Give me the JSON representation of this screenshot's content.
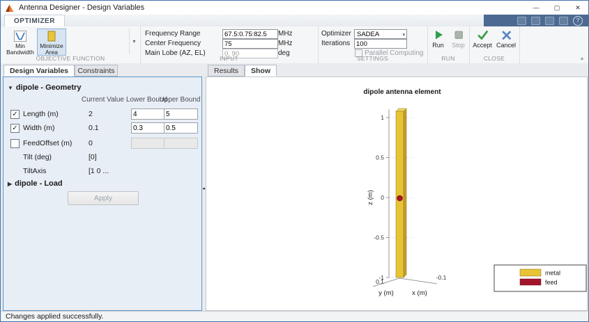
{
  "window": {
    "title": "Antenna Designer - Design Variables",
    "minimize_glyph": "—",
    "maximize_glyph": "▢",
    "close_glyph": "✕"
  },
  "ribbon": {
    "tab_label": "OPTIMIZER",
    "help_glyph": "?",
    "collapse_glyph": "▴",
    "gallery_arrow": "▾",
    "dropdown_arrow": "▾",
    "objective": {
      "section_label": "OBJECTIVE FUNCTION",
      "min_bandwidth_label": "Min Bandwidth",
      "minimize_area_label": "Minimize Area"
    },
    "input": {
      "section_label": "INPUT",
      "rows": [
        {
          "label": "Frequency Range",
          "value": "67.5:0.75:82.5",
          "unit": "MHz"
        },
        {
          "label": "Center Frequency",
          "value": "75",
          "unit": "MHz"
        },
        {
          "label": "Main Lobe (AZ, EL)",
          "value": "0, 90",
          "unit": "deg"
        }
      ]
    },
    "settings": {
      "section_label": "SETTINGS",
      "optimizer_label": "Optimizer",
      "optimizer_value": "SADEA",
      "iterations_label": "Iterations",
      "iterations_value": "100",
      "parallel_label": "Parallel Computing"
    },
    "run": {
      "section_label": "RUN",
      "run_label": "Run",
      "stop_label": "Stop"
    },
    "close": {
      "section_label": "CLOSE",
      "accept_label": "Accept",
      "cancel_label": "Cancel"
    }
  },
  "left_panel": {
    "tabs": [
      {
        "label": "Design Variables"
      },
      {
        "label": "Constraints"
      }
    ],
    "geometry": {
      "arrow": "▼",
      "header": "dipole - Geometry",
      "columns": [
        "Current Value",
        "Lower Bound",
        "Upper Bound"
      ],
      "rows": [
        {
          "label": "Length (m)",
          "check": "✓",
          "current": "2",
          "lower": "4",
          "upper": "5"
        },
        {
          "label": "Width (m)",
          "check": "✓",
          "current": "0.1",
          "lower": "0.3",
          "upper": "0.5"
        },
        {
          "label": "FeedOffset (m)",
          "check": "",
          "current": "0",
          "lower": "",
          "upper": ""
        }
      ],
      "info_rows": [
        {
          "label": "Tilt (deg)",
          "value": "[0]"
        },
        {
          "label": "TiltAxis",
          "value": "[1  0 ..."
        }
      ]
    },
    "load": {
      "arrow": "▶",
      "header": "dipole - Load"
    },
    "apply_label": "Apply",
    "splitter_glyph": "◂"
  },
  "right_panel": {
    "tabs": [
      {
        "label": "Results"
      },
      {
        "label": "Show"
      }
    ],
    "plot": {
      "title": "dipole antenna element",
      "z_label": "z (m)",
      "x_label": "x (m)",
      "y_label": "y (m)",
      "z_ticks": [
        "1",
        "0.5",
        "0",
        "-0.5",
        "-1"
      ],
      "x_tick": "-0.1",
      "y_tick": "0.1",
      "legend": [
        {
          "label": "metal",
          "color": "#E6C435"
        },
        {
          "label": "feed",
          "color": "#A3142B"
        }
      ]
    }
  },
  "status_bar": {
    "message": "Changes applied successfully."
  }
}
